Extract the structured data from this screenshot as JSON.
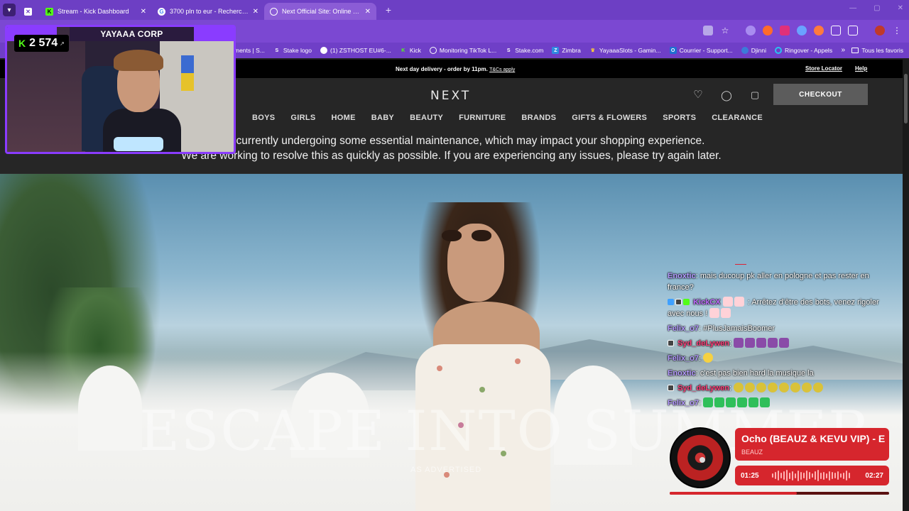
{
  "browser": {
    "tabs": [
      {
        "label": "",
        "icon": "apps-icon",
        "color": "#ffffff"
      },
      {
        "label": "Stream - Kick Dashboard",
        "icon": "kick-icon",
        "color": "#53fc18"
      },
      {
        "label": "3700 pln to eur - Recherche Go",
        "icon": "google-icon",
        "color": "#ffffff"
      },
      {
        "label": "Next Official Site: Online Fashio",
        "icon": "globe-icon",
        "color": "#ffffff"
      }
    ],
    "bookmarks": [
      {
        "label": "ments | S...",
        "icon": "page-icon"
      },
      {
        "label": "Stake logo",
        "icon": "stake-icon"
      },
      {
        "label": "(1) ZSTHOST EU#6-...",
        "icon": "circle-icon"
      },
      {
        "label": "Kick",
        "icon": "kick-icon"
      },
      {
        "label": "Monitoring TikTok L...",
        "icon": "globe-icon"
      },
      {
        "label": "Stake.com",
        "icon": "stake-icon"
      },
      {
        "label": "Zimbra",
        "icon": "zimbra-icon"
      },
      {
        "label": "YayaaaSlots - Gamin...",
        "icon": "crown-icon"
      },
      {
        "label": "Courrier - Support...",
        "icon": "mail-icon"
      },
      {
        "label": "Djinni",
        "icon": "djinni-icon"
      },
      {
        "label": "Ringover - Appels",
        "icon": "ringover-icon"
      }
    ],
    "all_bookmarks": "Tous les favoris"
  },
  "site": {
    "promo": "Next day delivery - order by 11pm.",
    "promo_link": "T&Cs apply",
    "store_locator": "Store Locator",
    "help": "Help",
    "logo": "NEXT",
    "checkout": "CHECKOUT",
    "nav": [
      "BOYS",
      "GIRLS",
      "HOME",
      "BABY",
      "BEAUTY",
      "FURNITURE",
      "BRANDS",
      "GIFTS & FLOWERS",
      "SPORTS",
      "CLEARANCE"
    ],
    "maintenance_line1": "We are currently undergoing some essential maintenance, which may impact your shopping experience.",
    "maintenance_line2": "We are working to resolve this as quickly as possible. If you are experiencing any issues, please try again later.",
    "hero_title": "ESCAPE INTO SUMMER",
    "hero_sub": "AS ADVERTISED"
  },
  "stream": {
    "channel": "YAYAAA CORP",
    "viewers": "2 574",
    "chat": [
      {
        "user": "Enoxtic",
        "color": "#b59aff",
        "text": ": mais ducoup pk aller en pologne et pas rester en france?"
      },
      {
        "user": "KickCX",
        "color": "#c06bff",
        "text": ": Arrêtez d'être des bots, venez rigoler avec nous !"
      },
      {
        "user": "Felix_o7",
        "color": "#b59aff",
        "text": ": #PlusJamaisBoomer"
      },
      {
        "user": "Syd_deLywen",
        "color": "#ff3f7a",
        "text": ":"
      },
      {
        "user": "Felix_o7",
        "color": "#b59aff",
        "text": ":"
      },
      {
        "user": "Enoxtic",
        "color": "#b59aff",
        "text": ": c'est pas bien hard la musique la"
      },
      {
        "user": "Syd_deLywen",
        "color": "#ff3f7a",
        "text": ":"
      },
      {
        "user": "Felix_o7",
        "color": "#b59aff",
        "text": ":"
      }
    ],
    "music": {
      "title": "Ocho (BEAUZ & KEVU VIP) - E",
      "artist": "BEAUZ",
      "elapsed": "01:25",
      "total": "02:27",
      "progress": 0.58
    }
  }
}
